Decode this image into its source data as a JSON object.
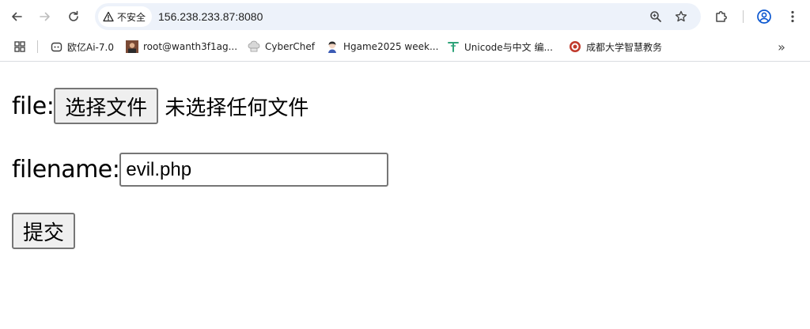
{
  "browser": {
    "address_bar": {
      "security_label": "不安全",
      "url": "156.238.233.87:8080"
    },
    "bookmarks": [
      {
        "label": "欧亿Ai-7.0",
        "icon": "discord-like-icon"
      },
      {
        "label": "root@wanth3f1ag...",
        "icon": "avatar-photo-icon"
      },
      {
        "label": "CyberChef",
        "icon": "chef-hat-icon"
      },
      {
        "label": "Hgame2025 week...",
        "icon": "anime-avatar-icon"
      },
      {
        "label": "Unicode与中文 编...",
        "icon": "t-logo-icon"
      },
      {
        "label": "成都大学智慧教务",
        "icon": "university-seal-icon"
      }
    ],
    "more_bookmarks": "»"
  },
  "form": {
    "file_label": "file:",
    "file_button": "选择文件",
    "file_status": "未选择任何文件",
    "filename_label": "filename:",
    "filename_value": "evil.php",
    "submit_label": "提交"
  },
  "colors": {
    "omnibox_bg": "#edf2fa",
    "button_bg": "#efefef",
    "border": "#767676"
  }
}
